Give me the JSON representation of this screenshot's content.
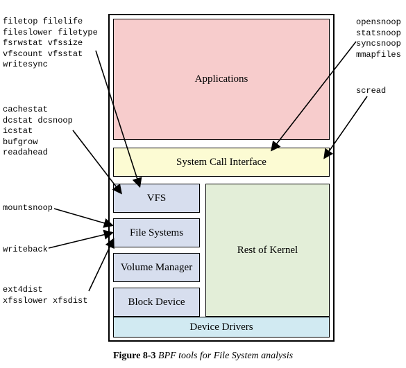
{
  "layers": {
    "applications": "Applications",
    "syscall": "System Call Interface",
    "vfs": "VFS",
    "file_systems": "File Systems",
    "volume_manager": "Volume Manager",
    "block_device": "Block Device",
    "rest_kernel": "Rest of Kernel",
    "device_drivers": "Device Drivers"
  },
  "labels": {
    "left1": "filetop filelife\nfileslower filetype\nfsrwstat vfssize\nvfscount vfsstat\nwritesync",
    "left2": "cachestat\ndcstat dcsnoop\nicstat\nbufgrow\nreadahead",
    "left3": "mountsnoop",
    "left4": "writeback",
    "left5": "ext4dist\nxfsslower xfsdist",
    "right1": "opensnoop\nstatsnoop\nsyncsnoop\nmmapfiles",
    "right2": "scread"
  },
  "caption": {
    "label": "Figure 8-3",
    "text": " BPF tools for File System analysis"
  }
}
